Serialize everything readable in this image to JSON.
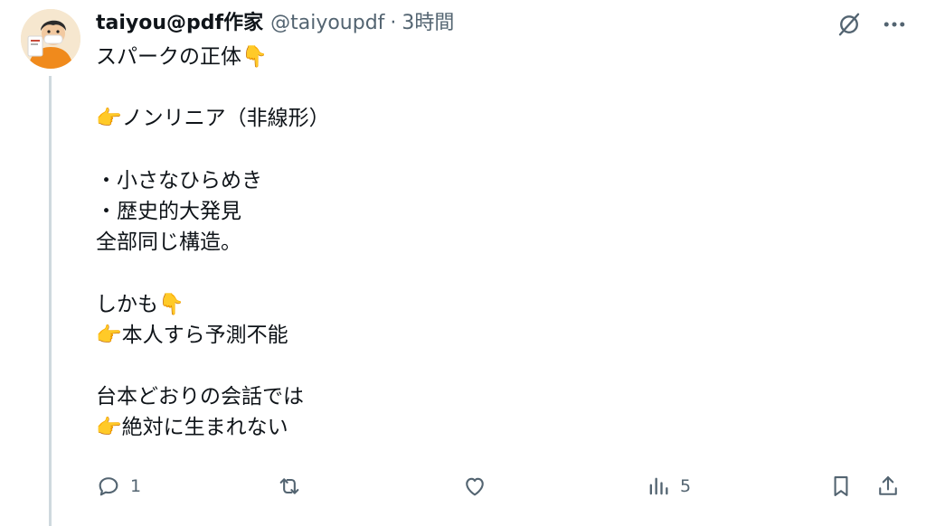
{
  "post": {
    "display_name": "taiyou@pdf作家",
    "handle": "@taiyoupdf",
    "separator": "·",
    "time": "3時間",
    "lines": [
      "スパークの正体👇",
      "",
      "👉ノンリニア（非線形）",
      "",
      "・小さなひらめき",
      "・歴史的大発見",
      "全部同じ構造。",
      "",
      "しかも👇",
      "👉本人すら予測不能",
      "",
      "台本どおりの会話では",
      "👉絶対に生まれない"
    ]
  },
  "actions": {
    "reply_count": "1",
    "views_count": "5"
  },
  "icons": {
    "top": [
      "grok-icon",
      "more-icon"
    ],
    "actions": [
      "reply-icon",
      "repost-icon",
      "like-icon",
      "views-icon",
      "bookmark-icon",
      "share-icon"
    ]
  },
  "colors": {
    "text": "#0f1419",
    "secondary": "#536471",
    "thread_line": "#cfd9de"
  }
}
